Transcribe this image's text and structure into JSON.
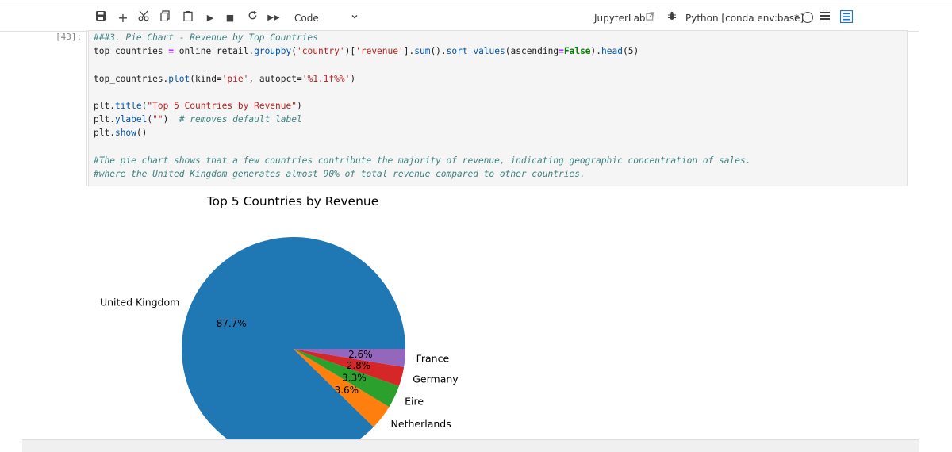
{
  "toolbar": {
    "icons": [
      "save-icon",
      "add-icon",
      "cut-icon",
      "copy-icon",
      "paste-icon",
      "run-icon",
      "stop-icon",
      "restart-icon",
      "fast-forward-icon"
    ],
    "cell_type": "Code",
    "jupyterlab_label": "JupyterLab",
    "kernel_label": "Python [conda env:base]",
    "kernel_marker": "*"
  },
  "cell": {
    "prompt": "[43]:",
    "lines": {
      "l1": "###3. Pie Chart - Revenue by Top Countries",
      "l2a": "top_countries ",
      "l2b": "=",
      "l2c": " online_retail.",
      "l2d": "groupby",
      "l2e": "(",
      "l2f": "'country'",
      "l2g": ")[",
      "l2h": "'revenue'",
      "l2i": "].",
      "l2j": "sum",
      "l2k": "().",
      "l2l": "sort_values",
      "l2m": "(ascending",
      "l2n": "=",
      "l2o": "False",
      "l2p": ").",
      "l2q": "head",
      "l2r": "(5)",
      "l3a": "top_countries.",
      "l3b": "plot",
      "l3c": "(kind=",
      "l3d": "'pie'",
      "l3e": ", autopct=",
      "l3f": "'%1.1f%%'",
      "l3g": ")",
      "l4a": "plt.",
      "l4b": "title",
      "l4c": "(",
      "l4d": "\"Top 5 Countries by Revenue\"",
      "l4e": ")",
      "l5a": "plt.",
      "l5b": "ylabel",
      "l5c": "(",
      "l5d": "\"\"",
      "l5e": ")  ",
      "l5f": "# removes default label",
      "l6a": "plt.",
      "l6b": "show",
      "l6c": "()",
      "l7": "#The pie chart shows that a few countries contribute the majority of revenue, indicating geographic concentration of sales.",
      "l8": "#where the United Kingdom generates almost 90% of total revenue compared to other countries."
    }
  },
  "chart_data": {
    "type": "pie",
    "title": "Top 5 Countries by Revenue",
    "categories": [
      "United Kingdom",
      "Netherlands",
      "Eire",
      "Germany",
      "France"
    ],
    "values": [
      87.7,
      3.6,
      3.3,
      2.8,
      2.6
    ],
    "pct_labels": [
      "87.7%",
      "3.6%",
      "3.3%",
      "2.8%",
      "2.6%"
    ],
    "colors": [
      "#1f77b4",
      "#ff7f0e",
      "#2ca02c",
      "#d62728",
      "#9467bd"
    ]
  }
}
